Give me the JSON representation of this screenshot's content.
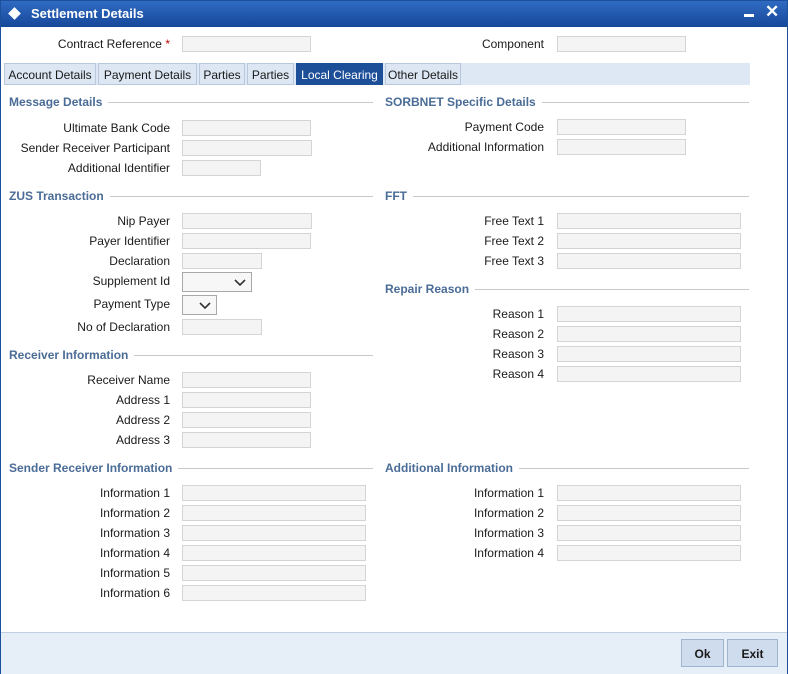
{
  "window": {
    "title": "Settlement Details"
  },
  "header": {
    "contract_reference_label": "Contract Reference",
    "required_marker": "*",
    "component_label": "Component"
  },
  "tabs": [
    {
      "label": "Account Details"
    },
    {
      "label": "Payment Details"
    },
    {
      "label": "Parties"
    },
    {
      "label": "Parties"
    },
    {
      "label": "Local Clearing"
    },
    {
      "label": "Other Details"
    }
  ],
  "active_tab": "Local Clearing",
  "message_details": {
    "title": "Message Details",
    "ultimate_bank_code": "Ultimate Bank Code",
    "sender_receiver_participant": "Sender Receiver Participant",
    "additional_identifier": "Additional Identifier"
  },
  "sorbnet": {
    "title": "SORBNET Specific Details",
    "payment_code": "Payment Code",
    "additional_information": "Additional Information"
  },
  "zus": {
    "title": "ZUS Transaction",
    "nip_payer": "Nip Payer",
    "payer_identifier": "Payer Identifier",
    "declaration": "Declaration",
    "supplement_id": "Supplement Id",
    "payment_type": "Payment Type",
    "no_of_declaration": "No of Declaration"
  },
  "fft": {
    "title": "FFT",
    "free_text_1": "Free Text 1",
    "free_text_2": "Free Text 2",
    "free_text_3": "Free Text 3"
  },
  "repair_reason": {
    "title": "Repair Reason",
    "reason_1": "Reason 1",
    "reason_2": "Reason 2",
    "reason_3": "Reason 3",
    "reason_4": "Reason 4"
  },
  "receiver_information": {
    "title": "Receiver Information",
    "receiver_name": "Receiver Name",
    "address_1": "Address 1",
    "address_2": "Address 2",
    "address_3": "Address 3"
  },
  "sender_receiver_information": {
    "title": "Sender Receiver Information",
    "information_1": "Information 1",
    "information_2": "Information 2",
    "information_3": "Information 3",
    "information_4": "Information 4",
    "information_5": "Information 5",
    "information_6": "Information 6"
  },
  "additional_information": {
    "title": "Additional Information",
    "information_1": "Information 1",
    "information_2": "Information 2",
    "information_3": "Information 3",
    "information_4": "Information 4"
  },
  "buttons": {
    "ok": "Ok",
    "exit": "Exit"
  },
  "icons": {
    "title": "diamond-icon",
    "minimize": "minimize-icon",
    "close": "close-icon",
    "dropdown": "chevron-down-icon"
  },
  "colors": {
    "title_bar": "#1d4f99",
    "active_tab": "#1d4f99",
    "section_title": "#4a6c96",
    "required": "#cc0000"
  }
}
